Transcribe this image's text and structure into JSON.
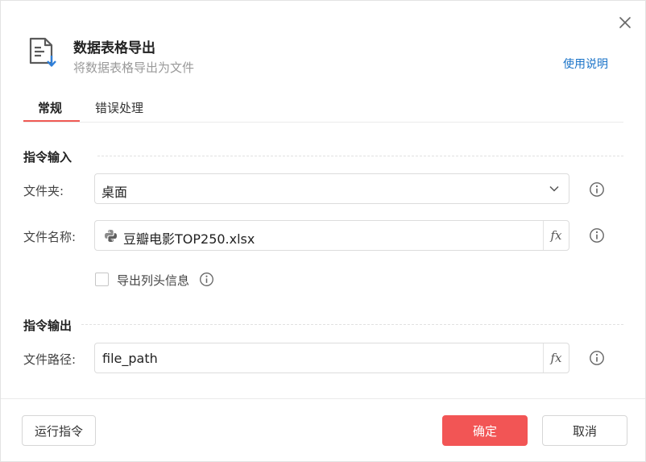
{
  "dialog": {
    "title": "数据表格导出",
    "subtitle": "将数据表格导出为文件",
    "help_link": "使用说明",
    "header_icon": "file-export-icon",
    "close_icon": "close-icon"
  },
  "tabs": [
    {
      "label": "常规",
      "active": true
    },
    {
      "label": "错误处理",
      "active": false
    }
  ],
  "sections": {
    "input_title": "指令输入",
    "output_title": "指令输出"
  },
  "fields": {
    "folder": {
      "label": "文件夹:",
      "value": "桌面",
      "icon": "chevron-down-icon"
    },
    "filename": {
      "label": "文件名称:",
      "value": "豆瓣电影TOP250.xlsx",
      "icon": "python-icon",
      "fx_label": "fx"
    },
    "export_header": {
      "label": "导出列头信息",
      "checked": false
    },
    "file_path": {
      "label": "文件路径:",
      "value": "file_path",
      "fx_label": "fx"
    }
  },
  "footer": {
    "run_label": "运行指令",
    "ok_label": "确定",
    "cancel_label": "取消"
  },
  "colors": {
    "accent": "#f25555",
    "link": "#1a73c8",
    "icon_blue": "#2f7fd8"
  }
}
